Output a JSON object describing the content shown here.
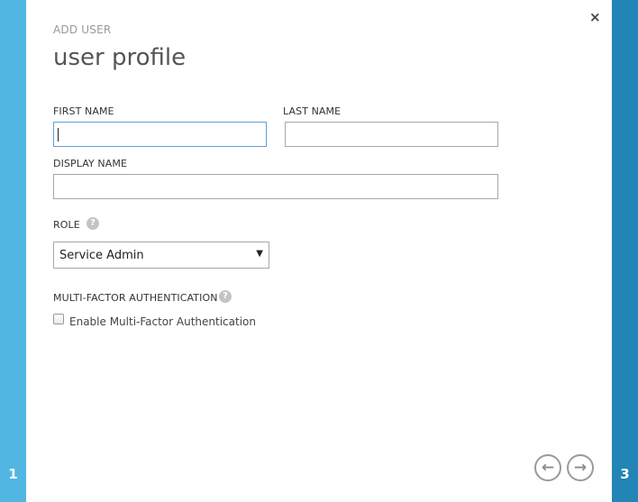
{
  "wizard": {
    "step_prev": "1",
    "step_next": "3",
    "kicker": "ADD USER",
    "title": "user profile",
    "close_glyph": "×"
  },
  "form": {
    "first_name": {
      "label": "FIRST NAME",
      "value": ""
    },
    "last_name": {
      "label": "LAST NAME",
      "value": ""
    },
    "display_name": {
      "label": "DISPLAY NAME",
      "value": ""
    },
    "role": {
      "label": "ROLE",
      "help_glyph": "?",
      "selected": "Service Admin",
      "arrow_glyph": "▼"
    },
    "mfa": {
      "label": "MULTI-FACTOR AUTHENTICATION",
      "help_glyph": "?",
      "checkbox_label": "Enable Multi-Factor Authentication",
      "checked": false
    }
  },
  "nav": {
    "back_glyph": "←",
    "next_glyph": "→"
  },
  "colors": {
    "left_rail": "#52b6e3",
    "right_rail": "#2285b5",
    "focus_border": "#5fa0d9"
  }
}
